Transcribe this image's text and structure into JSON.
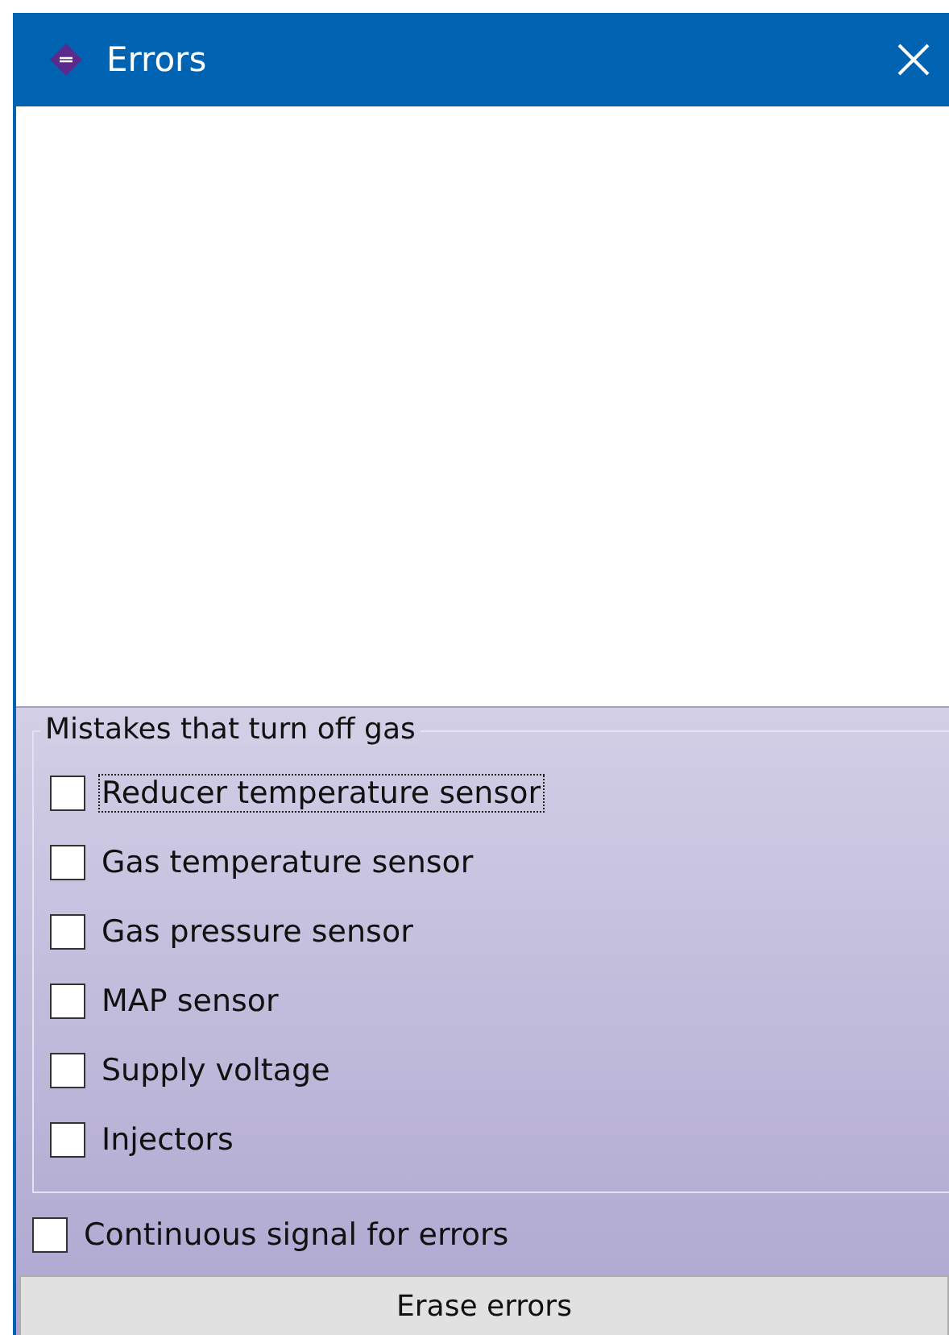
{
  "window": {
    "title": "Errors"
  },
  "group": {
    "title": "Mistakes that turn off gas",
    "items": [
      {
        "label": "Reducer temperature sensor",
        "checked": false,
        "focused": true
      },
      {
        "label": "Gas temperature sensor",
        "checked": false,
        "focused": false
      },
      {
        "label": "Gas pressure sensor",
        "checked": false,
        "focused": false
      },
      {
        "label": "MAP sensor",
        "checked": false,
        "focused": false
      },
      {
        "label": "Supply voltage",
        "checked": false,
        "focused": false
      },
      {
        "label": "Injectors",
        "checked": false,
        "focused": false
      }
    ]
  },
  "continuous_signal": {
    "label": "Continuous signal for errors",
    "checked": false
  },
  "buttons": [
    "Erase errors"
  ]
}
